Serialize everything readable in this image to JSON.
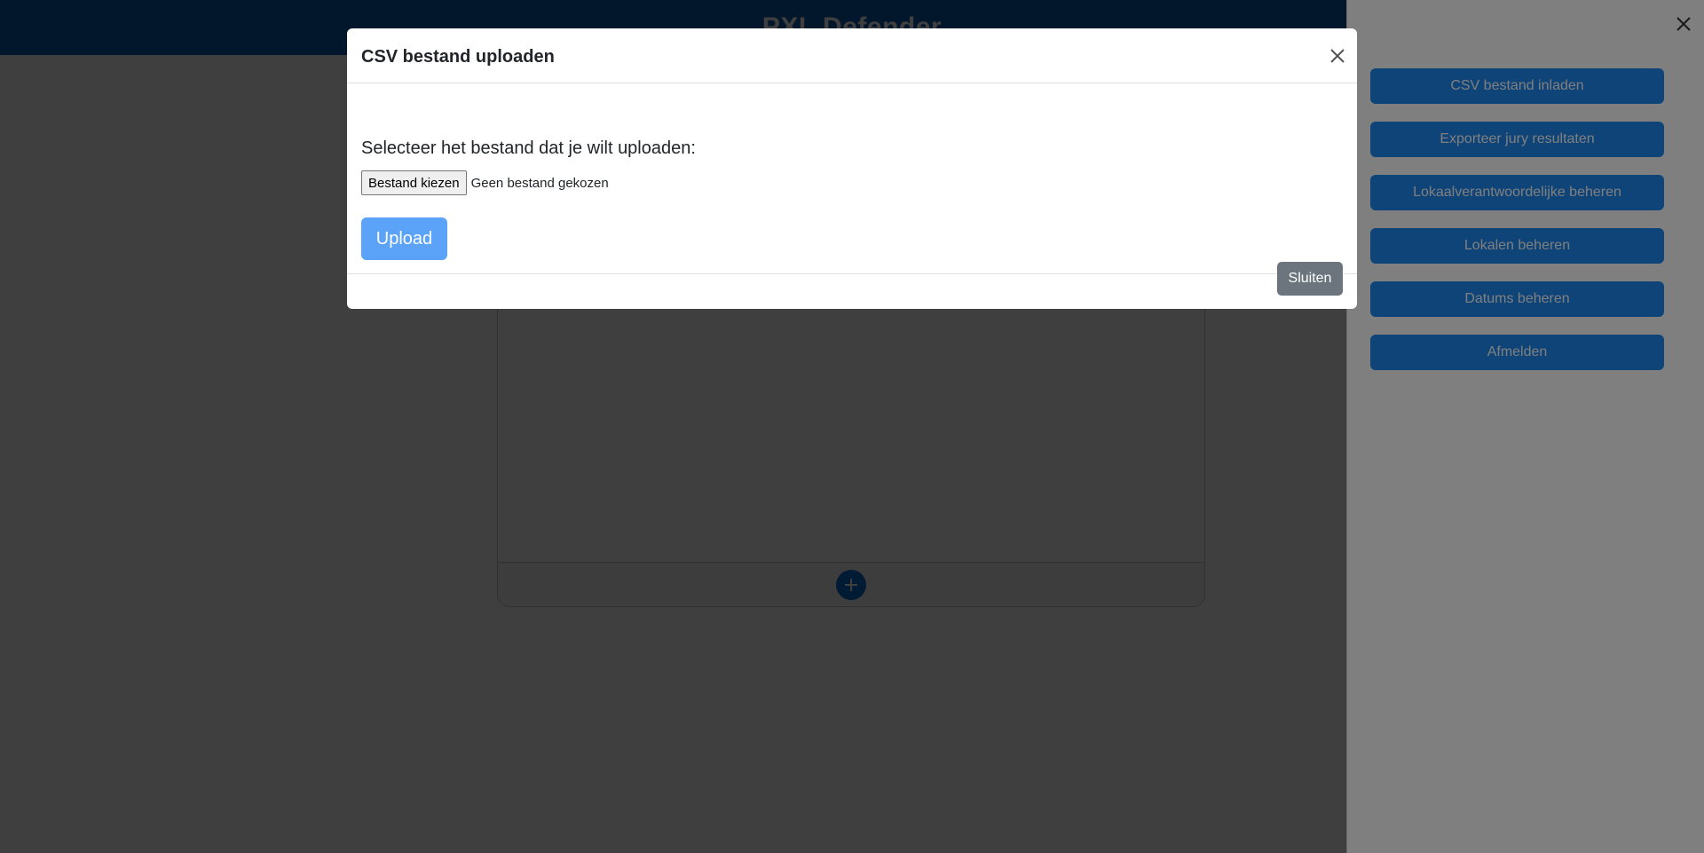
{
  "app": {
    "title": "PXL Defender"
  },
  "sidebar": {
    "items": [
      {
        "label": "CSV bestand inladen"
      },
      {
        "label": "Exporteer jury resultaten"
      },
      {
        "label": "Lokaalverantwoordelijke beheren"
      },
      {
        "label": "Lokalen beheren"
      },
      {
        "label": "Datums beheren"
      },
      {
        "label": "Afmelden"
      }
    ]
  },
  "modal": {
    "title": "CSV bestand uploaden",
    "prompt": "Selecteer het bestand dat je wilt uploaden:",
    "file_input": {
      "button_label": "Bestand kiezen",
      "status": "Geen bestand gekozen"
    },
    "upload_label": "Upload",
    "close_label": "Sluiten"
  },
  "colors": {
    "header": "#0b5db3",
    "sidebar_button": "#1e88f0",
    "upload_button": "#5aa3f8",
    "close_button": "#6c757d"
  },
  "icons": {
    "sidebar_close": "close-icon",
    "modal_close": "close-icon",
    "add": "plus-icon"
  }
}
